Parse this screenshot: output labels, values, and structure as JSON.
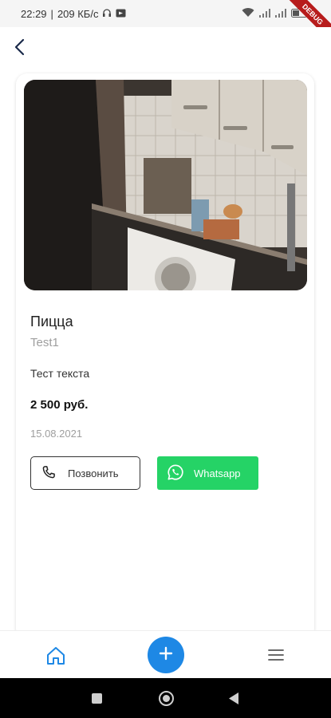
{
  "status_bar": {
    "time": "22:29",
    "speed": "209 КБ/с",
    "battery": "44"
  },
  "debug_ribbon": "DEBUG",
  "listing": {
    "title": "Пицца",
    "subtitle": "Test1",
    "description": "Тест текста",
    "price": "2 500 руб.",
    "date": "15.08.2021"
  },
  "actions": {
    "call_label": "Позвонить",
    "whatsapp_label": "Whatsapp"
  },
  "colors": {
    "accent": "#1e88e5",
    "whatsapp": "#25d366"
  },
  "icons": {
    "back": "chevron-left-icon",
    "phone": "phone-icon",
    "whatsapp": "whatsapp-icon",
    "home": "home-icon",
    "add": "plus-icon",
    "menu": "menu-icon"
  }
}
